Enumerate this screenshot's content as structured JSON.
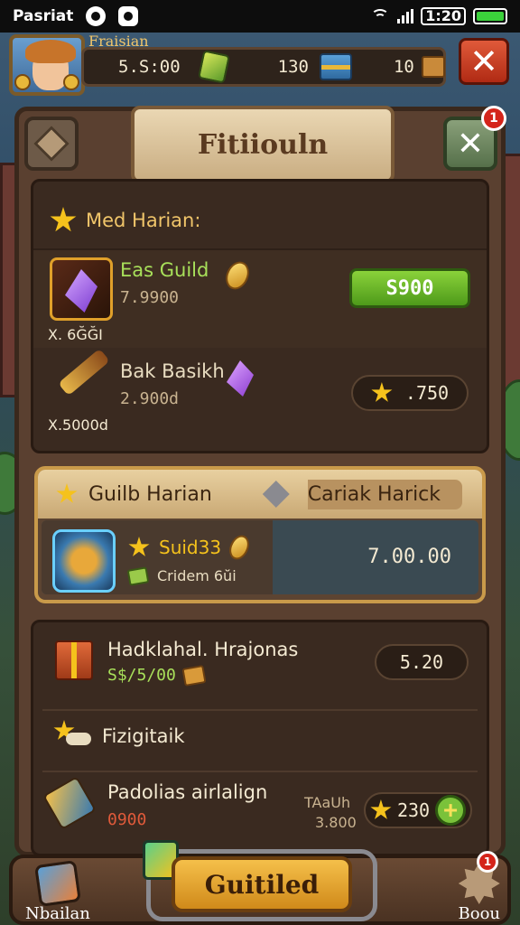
{
  "status_bar": {
    "carrier": "Pasriat",
    "time": "1:20",
    "icons": [
      "circle-dot-icon",
      "message-icon",
      "wifi-icon",
      "signal-icon",
      "battery-icon"
    ]
  },
  "top_bar": {
    "player_name": "Fraisian",
    "resources": [
      {
        "value": "5.S:00",
        "icon": "gem-icon"
      },
      {
        "value": "130",
        "icon": "chest-icon"
      },
      {
        "value": "10",
        "icon": "box-icon"
      }
    ],
    "close_label": "✕"
  },
  "panel": {
    "title": "Fitiiouln",
    "close_label": "✕",
    "close_badge": "1"
  },
  "section1": {
    "heading": "Med Harian:",
    "items": [
      {
        "name": "Eas Guild",
        "sub": "7.9900",
        "count": "X. 6ĞĞI",
        "button": "S900"
      },
      {
        "name": "Bak Basikh",
        "sub": "2.900d",
        "count": "X.5000d",
        "price": ".750"
      }
    ]
  },
  "section2": {
    "tab_left": "Guilb Harian",
    "tab_right": "Cariak Harick",
    "item_name": "Suid33",
    "item_sub": "Cridem 6ŭi",
    "value": "7.00.00"
  },
  "section3": {
    "row1_title": "Hadklahal. Hrajonas",
    "row1_sub": "S$/5/00",
    "row1_value": "5.20",
    "row2_title": "Fizigitaik",
    "row3_title": "Padolias airlalign",
    "row3_sub": "0900",
    "row3_aux_top": "TAaUh",
    "row3_aux_bottom": "3.800",
    "row3_value": "230",
    "plus_label": "+"
  },
  "bottom_nav": {
    "left_label": "Nbailan",
    "center_label": "Guitiled",
    "right_label": "Boou",
    "right_badge": "1"
  },
  "colors": {
    "gold": "#f0c56a",
    "green_button": "#6ab52a",
    "red_button": "#c83a20",
    "panel_brown": "#3b2b20"
  }
}
